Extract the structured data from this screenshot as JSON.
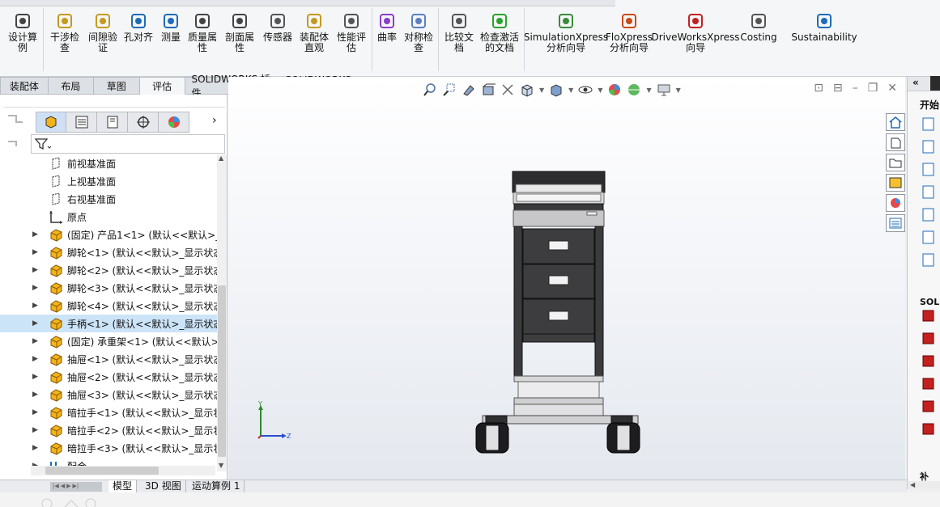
{
  "ribbon": {
    "buttons": [
      {
        "label": "设计算\n例",
        "icon": "design-study-icon"
      },
      {
        "label": "干涉检\n查",
        "icon": "interference-check-icon"
      },
      {
        "label": "间隙验\n证",
        "icon": "clearance-verification-icon"
      },
      {
        "label": "孔对齐",
        "icon": "hole-alignment-icon"
      },
      {
        "label": "测量",
        "icon": "measure-icon"
      },
      {
        "label": "质量属\n性",
        "icon": "mass-properties-icon"
      },
      {
        "label": "剖面属\n性",
        "icon": "section-properties-icon"
      },
      {
        "label": "传感器",
        "icon": "sensor-icon"
      },
      {
        "label": "装配体\n直观",
        "icon": "assemblyxpert-icon"
      },
      {
        "label": "性能评\n估",
        "icon": "performance-evaluation-icon"
      },
      {
        "label": "曲率",
        "icon": "curvature-icon"
      },
      {
        "label": "对称检\n查",
        "icon": "symmetry-check-icon"
      },
      {
        "label": "比较文\n档",
        "icon": "compare-documents-icon"
      },
      {
        "label": "检查激活\n的文档",
        "icon": "check-active-document-icon"
      },
      {
        "label": "SimulationXpress\n分析向导",
        "icon": "simulationxpress-icon"
      },
      {
        "label": "FloXpress\n分析向导",
        "icon": "floxpress-icon"
      },
      {
        "label": "DriveWorksXpress\n向导",
        "icon": "driveworksxpress-icon"
      },
      {
        "label": "Costing",
        "icon": "costing-icon"
      },
      {
        "label": "Sustainability",
        "icon": "sustainability-icon"
      }
    ]
  },
  "command_tabs": [
    "装配体",
    "布局",
    "草图",
    "评估",
    "SOLIDWORKS 插件",
    "SOLIDWORKS MBD"
  ],
  "active_command_tab": "评估",
  "tree": {
    "tabs": [
      "featuremanager-icon",
      "propertymanager-icon",
      "configurationmanager-icon",
      "dimxpert-icon",
      "displaymanager-icon"
    ],
    "items": [
      {
        "label": "前视基准面",
        "type": "plane",
        "expandable": false
      },
      {
        "label": "上视基准面",
        "type": "plane",
        "expandable": false
      },
      {
        "label": "右视基准面",
        "type": "plane",
        "expandable": false
      },
      {
        "label": "原点",
        "type": "origin",
        "expandable": false
      },
      {
        "label": "(固定) 产品1<1> (默认<<默认>_",
        "type": "part",
        "expandable": true
      },
      {
        "label": "脚轮<1> (默认<<默认>_显示状态",
        "type": "part",
        "expandable": true
      },
      {
        "label": "脚轮<2> (默认<<默认>_显示状态",
        "type": "part",
        "expandable": true
      },
      {
        "label": "脚轮<3> (默认<<默认>_显示状态",
        "type": "part",
        "expandable": true
      },
      {
        "label": "脚轮<4> (默认<<默认>_显示状态",
        "type": "part",
        "expandable": true
      },
      {
        "label": "手柄<1> (默认<<默认>_显示状态",
        "type": "part",
        "expandable": true,
        "selected": true
      },
      {
        "label": "(固定) 承重架<1> (默认<<默认>_",
        "type": "part",
        "expandable": true
      },
      {
        "label": "抽屉<1> (默认<<默认>_显示状态",
        "type": "part",
        "expandable": true
      },
      {
        "label": "抽屉<2> (默认<<默认>_显示状态",
        "type": "part",
        "expandable": true
      },
      {
        "label": "抽屉<3> (默认<<默认>_显示状态",
        "type": "part",
        "expandable": true
      },
      {
        "label": "暗拉手<1> (默认<<默认>_显示状",
        "type": "part",
        "expandable": true
      },
      {
        "label": "暗拉手<2> (默认<<默认>_显示状",
        "type": "part",
        "expandable": true
      },
      {
        "label": "暗拉手<3> (默认<<默认>_显示状",
        "type": "part",
        "expandable": true
      },
      {
        "label": "配合",
        "type": "mates",
        "expandable": true
      }
    ]
  },
  "triad": {
    "x": "Z",
    "y": "Y",
    "z": "Z"
  },
  "task_pane": {
    "title": "开始",
    "section": "SOLI",
    "bottom": "补"
  },
  "bottom_tabs": [
    "模型",
    "3D 视图",
    "运动算例 1"
  ],
  "active_bottom_tab": "模型",
  "colors": {
    "selection": "#cce4f7",
    "part_icon": "#f2b31b",
    "accent": "#1e6bb8"
  }
}
